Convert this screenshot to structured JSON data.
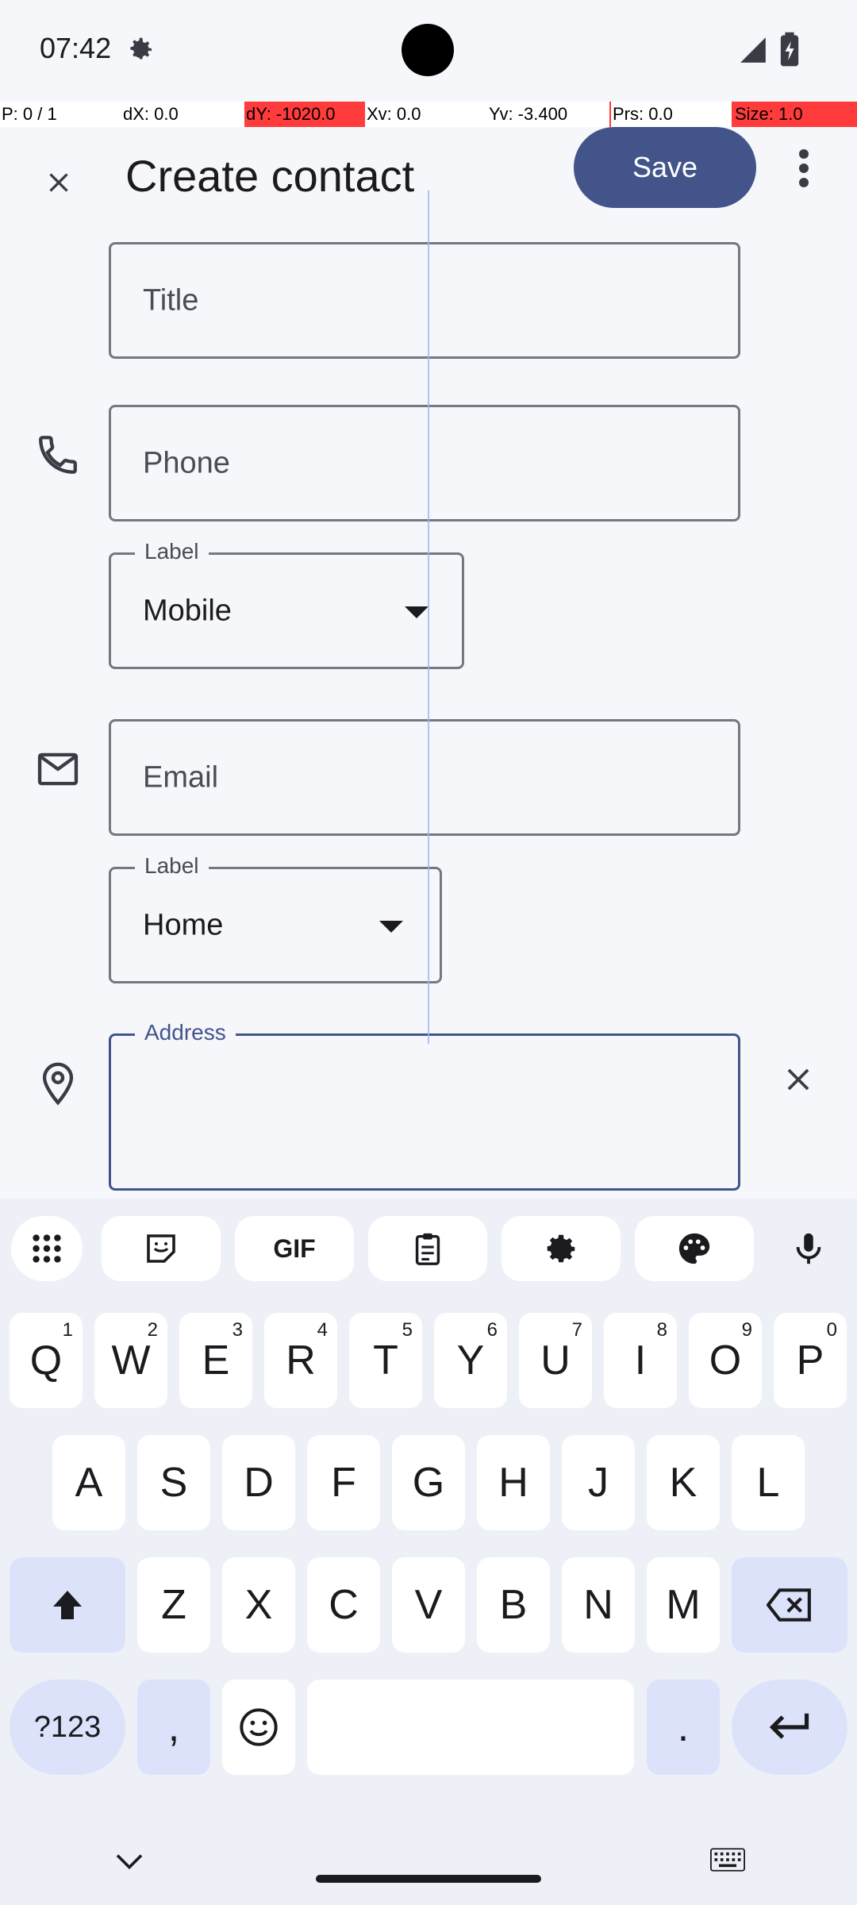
{
  "status": {
    "time": "07:42"
  },
  "debug": {
    "pointers": "P: 0 / 1",
    "dx": "dX: 0.0",
    "dy": "dY: -1020.0",
    "xv": "Xv: 0.0",
    "yv": "Yv: -3.400",
    "prs": "Prs: 0.0",
    "size": "Size: 1.0"
  },
  "appbar": {
    "title": "Create contact",
    "save_label": "Save"
  },
  "form": {
    "title_placeholder": "Title",
    "phone_placeholder": "Phone",
    "phone_label_legend": "Label",
    "phone_label_value": "Mobile",
    "email_placeholder": "Email",
    "email_label_legend": "Label",
    "email_label_value": "Home",
    "address_legend": "Address"
  },
  "keyboard": {
    "row1": [
      {
        "k": "Q",
        "h": "1"
      },
      {
        "k": "W",
        "h": "2"
      },
      {
        "k": "E",
        "h": "3"
      },
      {
        "k": "R",
        "h": "4"
      },
      {
        "k": "T",
        "h": "5"
      },
      {
        "k": "Y",
        "h": "6"
      },
      {
        "k": "U",
        "h": "7"
      },
      {
        "k": "I",
        "h": "8"
      },
      {
        "k": "O",
        "h": "9"
      },
      {
        "k": "P",
        "h": "0"
      }
    ],
    "row2": [
      "A",
      "S",
      "D",
      "F",
      "G",
      "H",
      "J",
      "K",
      "L"
    ],
    "row3": [
      "Z",
      "X",
      "C",
      "V",
      "B",
      "N",
      "M"
    ],
    "symbols_label": "?123",
    "comma_label": ",",
    "period_label": ".",
    "gif_label": "GIF"
  },
  "colors": {
    "accent": "#42548a",
    "keyboard_bg": "#eef0f7",
    "mod_key": "#dce2f9"
  }
}
